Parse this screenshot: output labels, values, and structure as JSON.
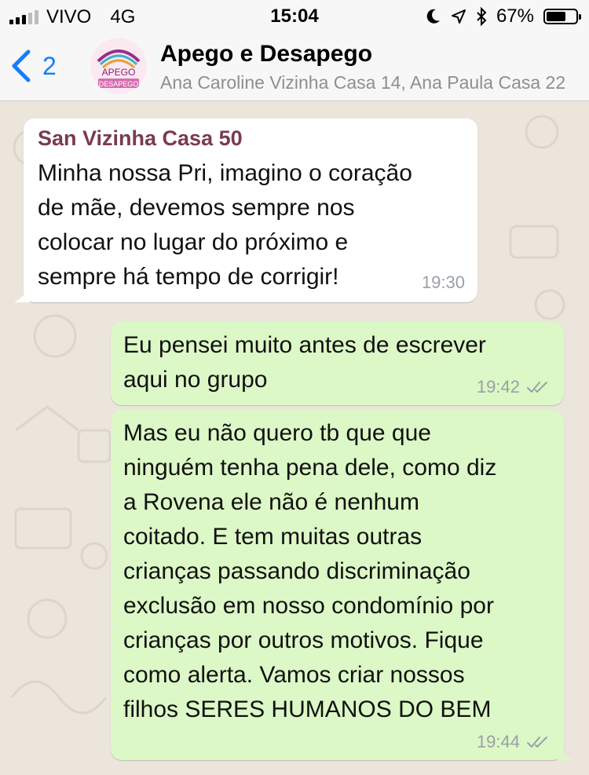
{
  "status_bar": {
    "carrier": "VIVO",
    "network": "4G",
    "time": "15:04",
    "battery_percent": "67%",
    "battery_level": 0.67,
    "icons": [
      "signal-icon",
      "moon-icon",
      "location-icon",
      "bluetooth-icon",
      "battery-icon"
    ]
  },
  "header": {
    "back_count": "2",
    "avatar_text_top": "APEGO",
    "avatar_text_bottom": "DESAPEGO",
    "title": "Apego e Desapego",
    "members": "Ana Caroline Vizinha Casa 14, Ana Paula Casa 22"
  },
  "messages": [
    {
      "direction": "incoming",
      "sender": "San Vizinha Casa 50",
      "text": "Minha nossa Pri, imagino o coração\nde mãe, devemos sempre nos\ncolocar no lugar do próximo e\nsempre há tempo de corrigir!",
      "time": "19:30"
    },
    {
      "direction": "outgoing",
      "text": "Eu pensei muito antes de escrever\naqui no grupo",
      "time": "19:42",
      "status": "read"
    },
    {
      "direction": "outgoing",
      "text": "Mas eu não quero tb que que\nninguém tenha pena dele, como diz\na Rovena ele não é nenhum\ncoitado. E tem muitas outras\ncrianças passando discriminação\nexclusão em nosso condomínio por\ncrianças por outros motivos. Fique\ncomo alerta. Vamos criar nossos\nfilhos SERES HUMANOS DO BEM",
      "time": "19:44",
      "status": "read"
    }
  ],
  "colors": {
    "accent": "#147efb",
    "incoming_bubble": "#ffffff",
    "outgoing_bubble": "#dcf8c6",
    "sender_name": "#7a3a4f",
    "wallpaper": "#ece5dc"
  }
}
